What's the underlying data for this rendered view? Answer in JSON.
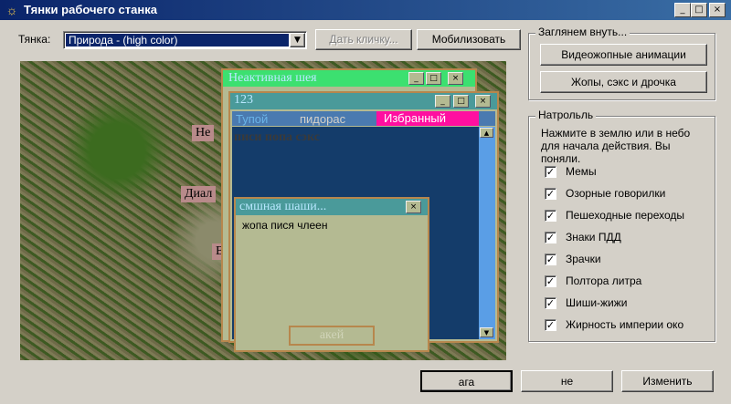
{
  "window": {
    "title": "Тянки рабочего станка"
  },
  "tyanka": {
    "label": "Тянка:",
    "selected": "Природа - (high color)",
    "name_button": "Дать кличку...",
    "mobilize_button": "Мобилизовать"
  },
  "look_inside": {
    "title": "Заглянем внуть...",
    "btn1": "Видеожопные анимации",
    "btn2": "Жопы, сэкс и дрочка"
  },
  "natrolle": {
    "title": "Натрольль",
    "hint": "Нажмите в землю или в небо для начала действия. Вы поняли.",
    "items": [
      {
        "label": "Мемы",
        "checked": true
      },
      {
        "label": "Озорные говорилки",
        "checked": true
      },
      {
        "label": "Пешеходные переходы",
        "checked": true
      },
      {
        "label": "Знаки ПДД",
        "checked": true
      },
      {
        "label": "Зрачки",
        "checked": true
      },
      {
        "label": "Полтора литра",
        "checked": true
      },
      {
        "label": "Шиши-жижи",
        "checked": true
      },
      {
        "label": "Жирность империи око",
        "checked": true
      }
    ]
  },
  "preview": {
    "tags": [
      "Не",
      "Диал",
      "В"
    ],
    "inactive_title": "Неактивная шея",
    "win123": {
      "title": "123",
      "tabs": [
        "Тупой",
        "пидорас",
        "Избранный"
      ],
      "body": "писи попа сэкс"
    },
    "funny": {
      "title": "смшная шаши...",
      "text": "жопа пися члеен",
      "button": "акей"
    }
  },
  "buttons": {
    "ok": "ага",
    "no": "не",
    "change": "Изменить"
  },
  "glyphs": {
    "minimize": "_",
    "maximize": "□",
    "close": "×",
    "dropdown": "▼",
    "check": "✓",
    "scroll_up": "▲",
    "scroll_down": "▼",
    "app_icon": "☼"
  },
  "colors": {
    "titlebar": "#0a246a",
    "tab_pink": "#ff0fa0",
    "win_blue": "#143c6a",
    "scroll": "#5a9ee6"
  }
}
